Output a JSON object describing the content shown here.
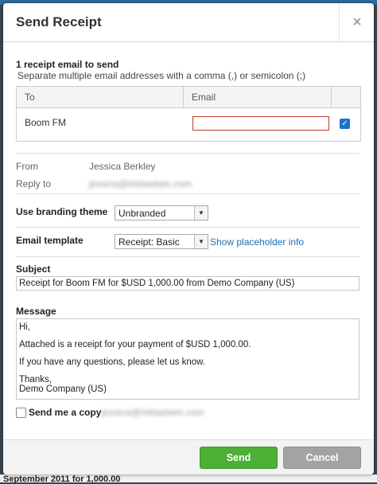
{
  "dialog": {
    "title": "Send Receipt",
    "close_glyph": "×"
  },
  "recipients": {
    "count_text": "1 receipt email to send",
    "hint": "Separate multiple email addresses with a comma (,) or semicolon (;)",
    "headers": {
      "to": "To",
      "email": "Email"
    },
    "rows": [
      {
        "name": "Boom FM",
        "email": "",
        "checked": true
      }
    ]
  },
  "sender": {
    "from_label": "From",
    "from_value": "Jessica Berkley",
    "reply_label": "Reply to",
    "reply_value": "jessica@hrblastwin.com"
  },
  "branding": {
    "label": "Use branding theme",
    "selected": "Unbranded"
  },
  "template": {
    "label": "Email template",
    "selected": "Receipt: Basic",
    "placeholder_link": "Show placeholder info"
  },
  "subject": {
    "label": "Subject",
    "value": "Receipt for Boom FM for $USD 1,000.00 from Demo Company (US)"
  },
  "message": {
    "label": "Message",
    "lines": [
      "Hi,",
      "Attached is a receipt for your payment of $USD 1,000.00.",
      "If you have any questions, please let us know.",
      "Thanks,",
      "Demo Company (US)"
    ]
  },
  "copy": {
    "label": "Send me a copy",
    "email": "jessica@hrblastwin.com",
    "checked": false
  },
  "buttons": {
    "send": "Send",
    "cancel": "Cancel"
  },
  "background_text": "September 2011 for 1,000.00",
  "colors": {
    "send": "#4caf36",
    "cancel": "#a3a3a3",
    "link": "#1a6fb5",
    "checkbox": "#1a73c9",
    "invalid_border": "#c0392b"
  }
}
